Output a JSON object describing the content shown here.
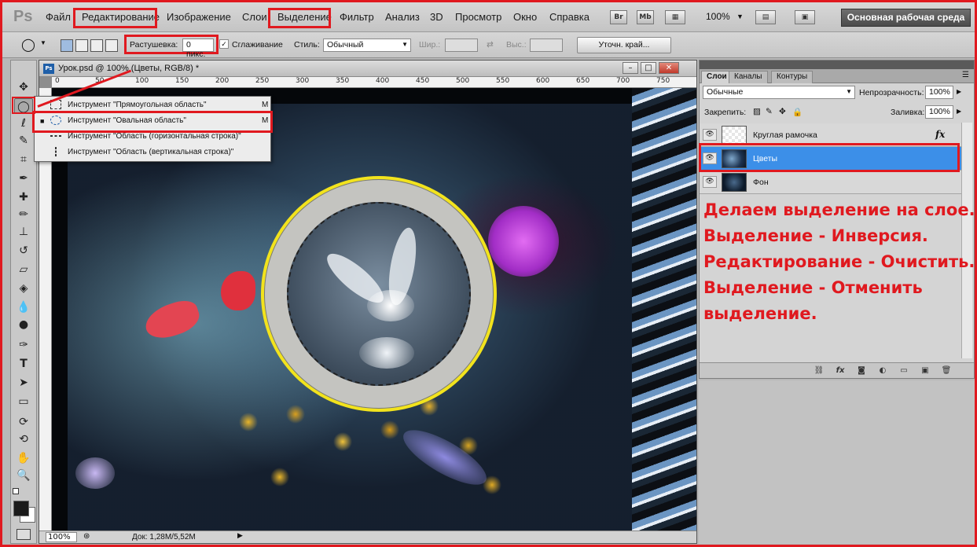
{
  "app": {
    "logo": "Ps"
  },
  "menu": {
    "items": [
      "Файл",
      "Редактирование",
      "Изображение",
      "Слои",
      "Выделение",
      "Фильтр",
      "Анализ",
      "3D",
      "Просмотр",
      "Окно",
      "Справка"
    ],
    "zoom": "100%",
    "workspace_button": "Основная рабочая среда",
    "bridge_label": "Br",
    "minibridge_label": "Mb"
  },
  "options": {
    "feather_label": "Растушевка:",
    "feather_value": "0 пикс.",
    "antialias_label": "Сглаживание",
    "antialias_checked": true,
    "style_label": "Стиль:",
    "style_value": "Обычный",
    "width_label": "Шир.:",
    "height_label": "Выс.:",
    "refine_button": "Уточн. край..."
  },
  "document": {
    "title": "Урок.psd @ 100% (Цветы, RGB/8) *",
    "ruler_numbers": [
      "0",
      "50",
      "100",
      "150",
      "200",
      "250",
      "300",
      "350",
      "400",
      "450",
      "500",
      "550",
      "600",
      "650",
      "700",
      "750"
    ],
    "zoom": "100%",
    "info": "Док: 1,28M/5,52M"
  },
  "flyout": {
    "items": [
      {
        "label": "Инструмент \"Прямоугольная область\"",
        "key": "M"
      },
      {
        "label": "Инструмент \"Овальная область\"",
        "key": "M"
      },
      {
        "label": "Инструмент \"Область (горизонтальная строка)\"",
        "key": ""
      },
      {
        "label": "Инструмент \"Область (вертикальная строка)\"",
        "key": ""
      }
    ]
  },
  "layers_panel": {
    "tabs": [
      "Слои",
      "Каналы",
      "Контуры"
    ],
    "blend_mode": "Обычные",
    "opacity_label": "Непрозрачность:",
    "opacity_value": "100%",
    "lock_label": "Закрепить:",
    "fill_label": "Заливка:",
    "fill_value": "100%",
    "layers": [
      {
        "name": "Круглая рамочка",
        "fx": "fx",
        "selected": false
      },
      {
        "name": "Цветы",
        "selected": true
      },
      {
        "name": "Фон",
        "selected": false
      }
    ]
  },
  "annotation": {
    "lines": [
      "Делаем выделение на слое.",
      "Выделение - Инверсия.",
      "Редактирование - Очистить.",
      "Выделение - Отменить",
      "выделение."
    ]
  },
  "colors": {
    "highlight_red": "#e0191f",
    "selected_layer_blue": "#3c8fe8",
    "frame_yellow": "#f2e31d"
  }
}
